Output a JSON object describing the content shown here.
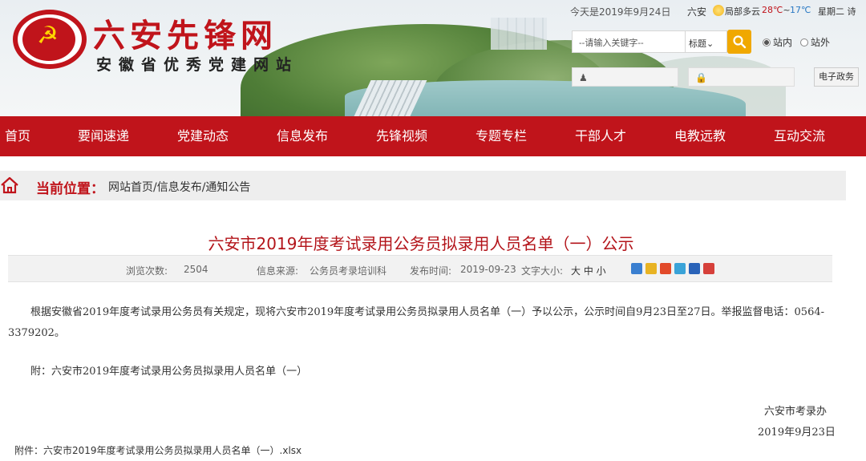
{
  "header": {
    "site_title": "六安先锋网",
    "site_subtitle": "安徽省优秀党建网站",
    "date": "今天是2019年9月24日",
    "city": "六安",
    "weather": "局部多云",
    "temp_high": "28℃",
    "temp_sep": "~",
    "temp_low": "17℃",
    "weekday": "星期二 诗",
    "search_placeholder": "--请输入关键字--",
    "search_scope": "标题",
    "radio_site": "站内",
    "radio_external": "站外",
    "egov_label": "电子政务"
  },
  "nav": [
    "首页",
    "要闻速递",
    "党建动态",
    "信息发布",
    "先锋视频",
    "专题专栏",
    "干部人才",
    "电教远教",
    "互动交流"
  ],
  "breadcrumb": {
    "label": "当前位置：",
    "path": "网站首页/信息发布/通知公告"
  },
  "article": {
    "title": "六安市2019年度考试录用公务员拟录用人员名单（一）公示",
    "views_label": "浏览次数:",
    "views": "2504",
    "source_label": "信息来源:",
    "source": "公务员考录培训科",
    "published_label": "发布时间:",
    "published": "2019-09-23",
    "font_size_label": "文字大小:",
    "font_size_options": "大 中 小",
    "paragraph": "根据安徽省2019年度考试录用公务员有关规定，现将六安市2019年度考试录用公务员拟录用人员名单（一）予以公示，公示时间自9月23日至27日。举报监督电话：0564-3379202。",
    "attachment_note": "附：六安市2019年度考试录用公务员拟录用人员名单（一）",
    "signature": "六安市考录办",
    "signature_date": "2019年9月23日",
    "file": "附件：六安市2019年度考试录用公务员拟录用人员名单（一）.xlsx"
  },
  "colors": {
    "brand": "#c0141b",
    "search_button": "#f0a800"
  }
}
